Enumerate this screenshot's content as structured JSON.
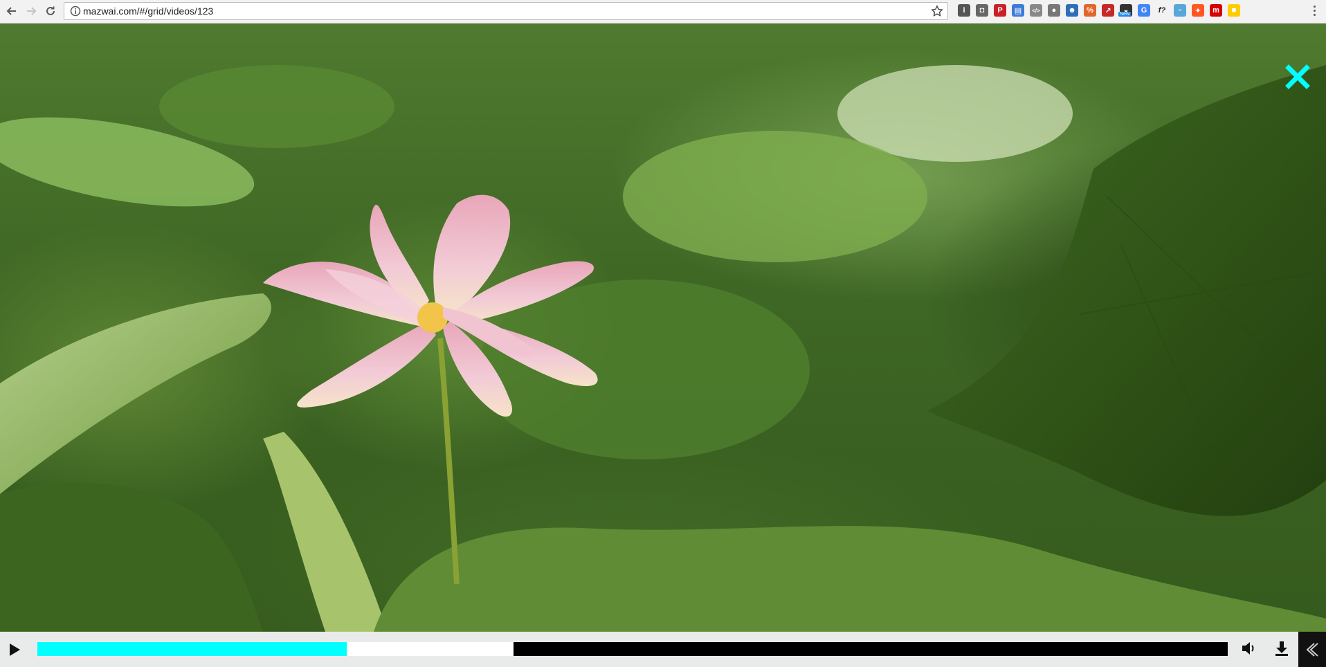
{
  "browser": {
    "url": "mazwai.com/#/grid/videos/123",
    "nav_icons": [
      "back-arrow-icon",
      "forward-arrow-icon",
      "reload-icon"
    ],
    "address_bar_icons": [
      "info-icon",
      "bookmark-star-icon"
    ],
    "extensions": [
      {
        "name": "info-circle-extension-icon",
        "color": "#555555",
        "glyph": "i"
      },
      {
        "name": "camera-extension-icon",
        "color": "#666666",
        "glyph": "◘"
      },
      {
        "name": "pinterest-extension-icon",
        "color": "#cb2027",
        "glyph": "P"
      },
      {
        "name": "page-extension-icon",
        "color": "#3d7cd6",
        "glyph": "▤"
      },
      {
        "name": "code-extension-icon",
        "color": "#888888",
        "glyph": "</>"
      },
      {
        "name": "circle-extension-icon",
        "color": "#777777",
        "glyph": "●"
      },
      {
        "name": "user-extension-icon",
        "color": "#2f6db8",
        "glyph": "☻"
      },
      {
        "name": "percent-extension-icon",
        "color": "#e2662b",
        "glyph": "%"
      },
      {
        "name": "red-arrow-extension-icon",
        "color": "#c62828",
        "glyph": "↗"
      },
      {
        "name": "new-badge-extension-icon",
        "color": "#333333",
        "glyph": "◒",
        "badge": "New"
      },
      {
        "name": "translate-extension-icon",
        "color": "#4285f4",
        "glyph": "G"
      },
      {
        "name": "font-extension-icon",
        "color": "#ffffff",
        "glyph": "f?"
      },
      {
        "name": "box-extension-icon",
        "color": "#57a8d9",
        "glyph": "▫"
      },
      {
        "name": "fire-extension-icon",
        "color": "#ff5722",
        "glyph": "✦"
      },
      {
        "name": "m-extension-icon",
        "color": "#d50000",
        "glyph": "m"
      },
      {
        "name": "flag-extension-icon",
        "color": "#ffcc00",
        "glyph": "■"
      }
    ],
    "menu_icon": "more-vertical-icon"
  },
  "player": {
    "close_icon": "close-x-icon",
    "accent_color": "#00ffff",
    "played_fraction": 0.26,
    "buffered_fraction": 0.4,
    "controls": [
      "play-icon",
      "volume-icon",
      "download-icon",
      "collapse-panel-icon"
    ]
  }
}
